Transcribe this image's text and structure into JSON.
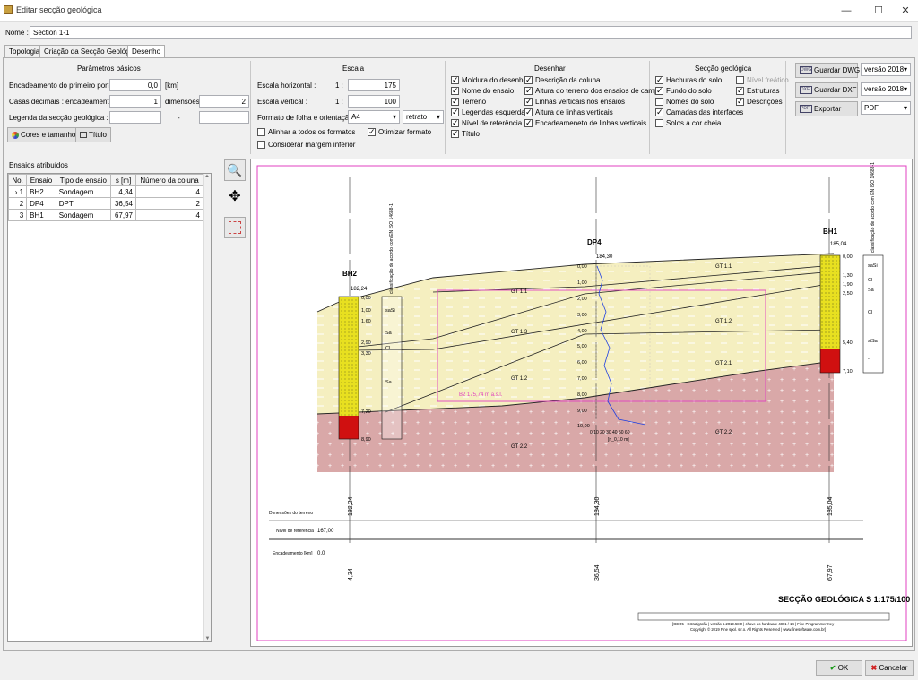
{
  "window": {
    "title": "Editar secção geológica",
    "minimize": "—",
    "maximize": "☐",
    "close": "✕"
  },
  "name_label": "Nome :",
  "name_value": "Section 1-1",
  "tabs": [
    "Topologia",
    "Criação da Secção Geológica",
    "Desenho"
  ],
  "basic": {
    "title": "Parâmetros básicos",
    "first_point_label": "Encadeamento do primeiro ponto :",
    "first_point_value": "0,0",
    "first_point_unit": "[km]",
    "decimals_label": "Casas decimais : encadeamento :",
    "decimals_value": "1",
    "dims_label": "dimensões :",
    "dims_value": "2",
    "legend_label": "Legenda da secção geológica :",
    "legend_dash": "-",
    "colors_btn": "Cores e tamanhos",
    "title_btn": "Título"
  },
  "scale": {
    "title": "Escala",
    "h_label": "Escala horizontal :",
    "h_ratio": "1 :",
    "h_value": "175",
    "v_label": "Escala vertical :",
    "v_ratio": "1 :",
    "v_value": "100",
    "format_label": "Formato de folha e orientação :",
    "format_value": "A4",
    "orient_value": "retrato",
    "align_label": "Alinhar a todos os formatos",
    "optimize_label": "Otimizar formato",
    "bottom_margin_label": "Considerar margem inferior"
  },
  "draw": {
    "title": "Desenhar",
    "col1": [
      {
        "label": "Moldura do desenho",
        "on": true
      },
      {
        "label": "Nome do ensaio",
        "on": true
      },
      {
        "label": "Terreno",
        "on": true
      },
      {
        "label": "Legendas esquerdas",
        "on": true
      },
      {
        "label": "Nível de referência",
        "on": true
      },
      {
        "label": "Título",
        "on": true
      }
    ],
    "col2": [
      {
        "label": "Descrição da coluna",
        "on": true
      },
      {
        "label": "Altura do terreno dos ensaios de campo",
        "on": true
      },
      {
        "label": "Linhas verticais nos ensaios",
        "on": true
      },
      {
        "label": "Altura de linhas verticais",
        "on": true
      },
      {
        "label": "Encadeameneto de linhas verticais",
        "on": true
      }
    ]
  },
  "section": {
    "title": "Secção geológica",
    "col1": [
      {
        "label": "Hachuras do solo",
        "on": true
      },
      {
        "label": "Fundo do solo",
        "on": true
      },
      {
        "label": "Nomes do solo",
        "on": false
      },
      {
        "label": "Camadas das interfaces",
        "on": true
      },
      {
        "label": "Solos a cor cheia",
        "on": false
      }
    ],
    "col2": [
      {
        "label": "Nível freático",
        "on": false
      },
      {
        "label": "Estruturas",
        "on": true
      },
      {
        "label": "Descrições",
        "on": true
      }
    ]
  },
  "export": {
    "dwg_btn": "Guardar DWG",
    "dwg_ver": "versão 2018",
    "dxf_btn": "Guardar DXF",
    "dxf_ver": "versão 2018",
    "export_btn": "Exportar",
    "export_fmt": "PDF"
  },
  "tests": {
    "title": "Ensaios atribuídos",
    "headers": [
      "No.",
      "Ensaio",
      "Tipo de ensaio",
      "s [m]",
      "Número da coluna"
    ],
    "rows": [
      [
        "1",
        "BH2",
        "Sondagem",
        "4,34",
        "4"
      ],
      [
        "2",
        "DP4",
        "DPT",
        "36,54",
        "2"
      ],
      [
        "3",
        "BH1",
        "Sondagem",
        "67,97",
        "4"
      ]
    ]
  },
  "drawing": {
    "bh2": "BH2",
    "bh2_elev": "182,24",
    "dp4": "DP4",
    "dp4_elev": "184,30",
    "bh1": "BH1",
    "bh1_elev": "185,04",
    "col_desc": "classificação de acordo com EN ISO 14688-1",
    "bh2_layers": [
      "saSi",
      "Sa",
      "Cl",
      "Sa"
    ],
    "bh1_layers": [
      "saSi",
      "Cl",
      "Sa",
      "Cl",
      "siSa",
      "-"
    ],
    "bh2_depths": [
      "0,00",
      "1,00",
      "1,60",
      "2,90",
      "3,30",
      "7,20",
      "8,90"
    ],
    "bh1_depths": [
      "0,00",
      "1,30",
      "1,90",
      "2,50",
      "5,40",
      "7,10"
    ],
    "dp4_depths": [
      "0,00",
      "1,00",
      "2,00",
      "3,00",
      "4,00",
      "5,00",
      "6,00",
      "7,00",
      "8,00",
      "9,00",
      "10,00"
    ],
    "dp4_axis": "0 10 20 30 40 50 60",
    "dp4_unit": "[n_0,10 m]",
    "soil_labels": [
      "GT 1.1",
      "GT 1.3",
      "GT 1.2",
      "GT 1.1",
      "GT 1.2",
      "GT 2.1",
      "GT 1.2",
      "GT 2.2",
      "GT 2.2"
    ],
    "structure_label": "B2 175,74 m a.s.l.",
    "row_terrain": "Dimensões do terreno",
    "row_ref": "Nível de referência",
    "row_ref_value": "167,00",
    "row_chain": "Encadeamento [km]",
    "row_chain_value": "0,0",
    "terrain_vals": [
      "182,24",
      "184,30",
      "185,04"
    ],
    "chain_vals": [
      "4,34",
      "36,54",
      "67,97"
    ],
    "sheet_title": "SECÇÃO GEOLÓGICA S 1:175/100",
    "footer1": "[GEO5 - Estratigrafia | versão 5.2019.58.0 | chave do hardware 4801 / 14 | Fine Programmer Key",
    "footer2": "Copyright © 2019 Fine spol. s r.o. All Rights Reserved | www.finesoftware.com.br]"
  },
  "ok_btn": "OK",
  "cancel_btn": "Cancelar",
  "colors": {
    "sand": "#f5efc0",
    "clay": "#d9a8a8",
    "bh_yellow": "#e8e020",
    "bh_red": "#d01010",
    "frame": "#e040c0"
  }
}
